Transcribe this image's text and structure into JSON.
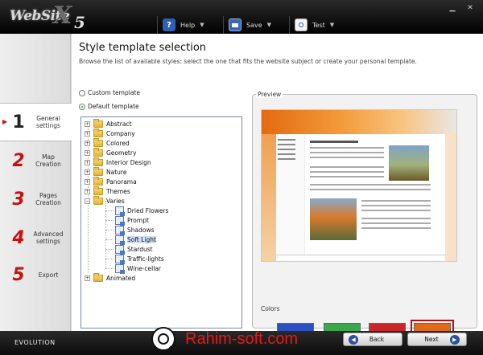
{
  "app": {
    "logo_text": "WebSite",
    "logo_x": "X",
    "logo_5": "5"
  },
  "toolbar": {
    "help_label": "Help",
    "save_label": "Save",
    "test_label": "Test"
  },
  "sidebar": {
    "items": [
      {
        "num": "1",
        "label": "General settings"
      },
      {
        "num": "2",
        "label": "Map Creation"
      },
      {
        "num": "3",
        "label": "Pages Creation"
      },
      {
        "num": "4",
        "label": "Advanced settings"
      },
      {
        "num": "5",
        "label": "Export"
      }
    ]
  },
  "main": {
    "title": "Style template selection",
    "subtitle": "Browse the list of available styles: select the one that fits the website subject or create your personal template."
  },
  "options": {
    "custom_label": "Custom template",
    "default_label": "Default template"
  },
  "tree": {
    "categories": [
      "Abstract",
      "Company",
      "Colored",
      "Geometry",
      "Interior Design",
      "Nature",
      "Panorama",
      "Themes",
      "Varies"
    ],
    "children": [
      "Dried Flowers",
      "Prompt",
      "Shadows",
      "Soft Light",
      "Stardust",
      "Traffic-lights",
      "Wine-cellar"
    ],
    "selected": "Soft Light",
    "last": "Animated"
  },
  "preview": {
    "label": "Preview",
    "colors_label": "Colors",
    "swatches": [
      "#2e4fc2",
      "#3aa84a",
      "#c8262a",
      "#e06a18"
    ],
    "selected_swatch": 3
  },
  "footer": {
    "edition": "EVOLUTION",
    "back_label": "Back",
    "next_label": "Next"
  },
  "watermark": {
    "text": "Rahim-soft.com"
  }
}
